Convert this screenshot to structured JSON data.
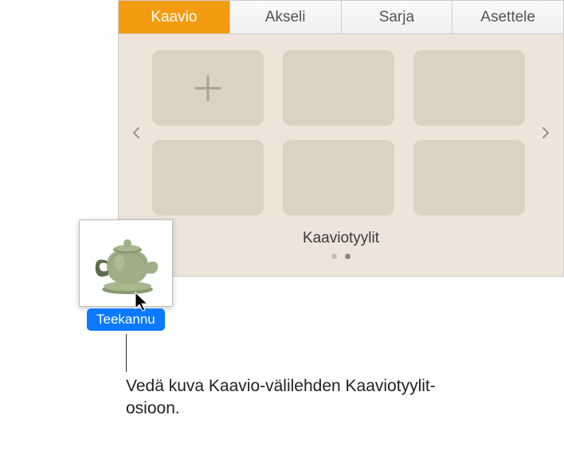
{
  "tabs": {
    "chart": "Kaavio",
    "axis": "Akseli",
    "series": "Sarja",
    "arrange": "Asettele"
  },
  "styles": {
    "label": "Kaaviotyylit"
  },
  "drag": {
    "label": "Teekannu"
  },
  "callout": {
    "text": "Vedä kuva Kaavio-välilehden Kaaviotyylit-osioon."
  }
}
